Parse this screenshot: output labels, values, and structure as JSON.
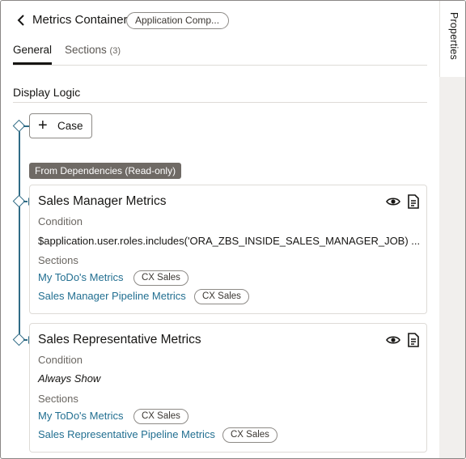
{
  "header": {
    "title": "Metrics Container",
    "context_pill": "Application Comp..."
  },
  "tabs": [
    {
      "label": "General",
      "selected": true
    },
    {
      "label": "Sections",
      "count": "(3)",
      "selected": false
    }
  ],
  "side_panel": {
    "label": "Properties"
  },
  "display_logic": {
    "title": "Display Logic",
    "case_button": "Case",
    "dependencies_badge": "From Dependencies (Read-only)",
    "cases": [
      {
        "title": "Sales Manager Metrics",
        "condition_label": "Condition",
        "condition": "$application.user.roles.includes('ORA_ZBS_INSIDE_SALES_MANAGER_JOB) ...",
        "sections_label": "Sections",
        "sections": [
          {
            "name": "My ToDo's Metrics",
            "tag": "CX Sales"
          },
          {
            "name": "Sales Manager Pipeline Metrics",
            "tag": "CX Sales"
          }
        ]
      },
      {
        "title": "Sales Representative Metrics",
        "condition_label": "Condition",
        "condition": "Always Show",
        "sections_label": "Sections",
        "sections": [
          {
            "name": "My ToDo's Metrics",
            "tag": "CX Sales"
          },
          {
            "name": "Sales Representative Pipeline Metrics",
            "tag": "CX Sales"
          }
        ]
      }
    ]
  },
  "colors": {
    "accent_line": "#2f6b85",
    "link": "#226f91",
    "badge_bg": "#6f6a65"
  }
}
